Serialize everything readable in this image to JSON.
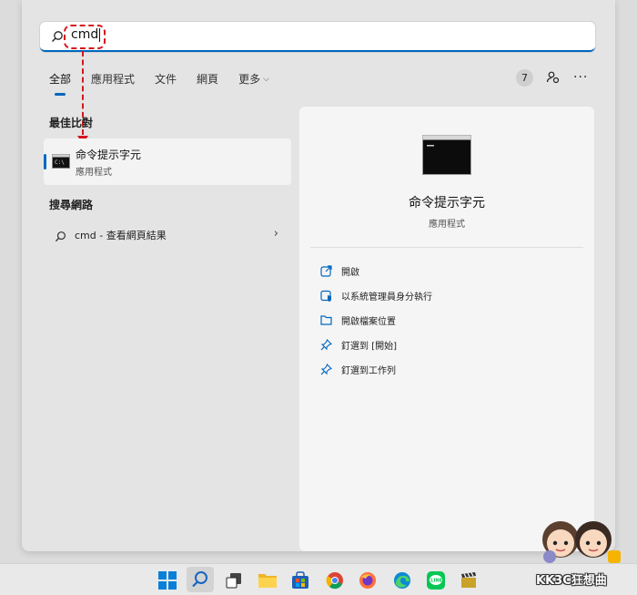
{
  "search": {
    "query": "cmd"
  },
  "tabs": [
    {
      "label": "全部",
      "active": true
    },
    {
      "label": "應用程式"
    },
    {
      "label": "文件"
    },
    {
      "label": "網頁"
    },
    {
      "label": "更多"
    }
  ],
  "header": {
    "badge_count": "7"
  },
  "best_match": {
    "section_label": "最佳比對",
    "title": "命令提示字元",
    "subtitle": "應用程式"
  },
  "web_search": {
    "section_label": "搜尋網路",
    "item_text": "cmd - 查看網頁結果"
  },
  "detail": {
    "name": "命令提示字元",
    "kind": "應用程式",
    "actions": [
      {
        "label": "開啟",
        "icon": "open-external-icon"
      },
      {
        "label": "以系統管理員身分執行",
        "icon": "shield-admin-icon"
      },
      {
        "label": "開啟檔案位置",
        "icon": "folder-icon"
      },
      {
        "label": "釘選到 [開始]",
        "icon": "pin-icon"
      },
      {
        "label": "釘選到工作列",
        "icon": "pin-icon"
      }
    ]
  },
  "taskbar": {
    "icons": [
      "windows-start-icon",
      "search-icon",
      "task-view-icon",
      "file-explorer-icon",
      "store-icon",
      "chrome-icon",
      "firefox-icon",
      "edge-icon",
      "line-icon",
      "clapper-icon"
    ]
  },
  "watermark": {
    "text": "KK3C狂想曲"
  },
  "colors": {
    "accent": "#0067c0",
    "annotation": "#d6161d"
  }
}
